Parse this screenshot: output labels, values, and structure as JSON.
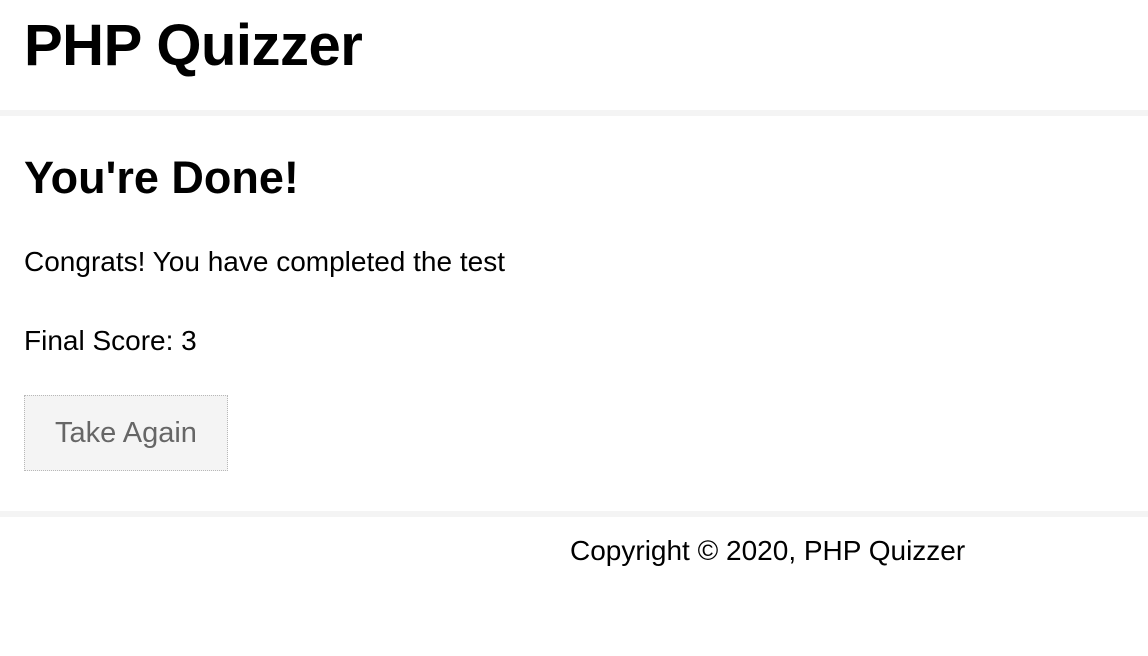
{
  "header": {
    "title": "PHP Quizzer"
  },
  "main": {
    "heading": "You're Done!",
    "message": "Congrats! You have completed the test",
    "score_label": "Final Score: 3",
    "take_again_label": "Take Again"
  },
  "footer": {
    "copyright": "Copyright © 2020, PHP Quizzer"
  }
}
